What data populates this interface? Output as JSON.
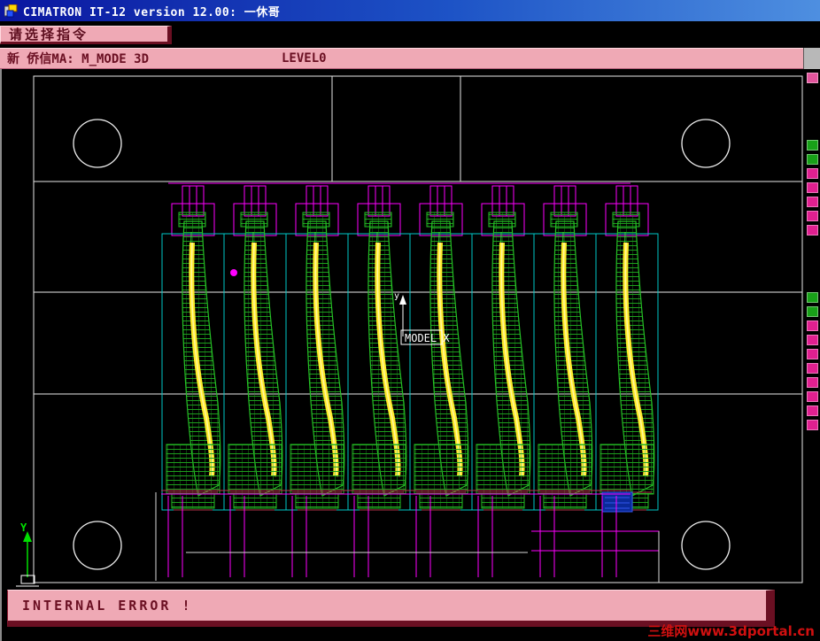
{
  "window": {
    "title": "CIMATRON IT-12 version 12.00: 一休哥"
  },
  "prompt_bar": {
    "text": "请选择指令"
  },
  "status_bar": {
    "mode_text": "新 侨信MA:  M_MODE  3D",
    "level": "LEVEL0"
  },
  "viewport": {
    "axis_label": "MODEL X",
    "center_y_label": "y",
    "origin_y_label": "Y"
  },
  "error_bar": {
    "text": "INTERNAL ERROR !"
  },
  "watermark": {
    "text": "三维网www.3dportal.cn"
  },
  "right_toolbar": {
    "buttons": [
      "#e2559c",
      "#18a018",
      "#18a018",
      "#e02090",
      "#e02090",
      "#e02090",
      "#e02090",
      "#e02090",
      "#18a018",
      "#18a018",
      "#e02090",
      "#e02090",
      "#e02090",
      "#e02090",
      "#e02090",
      "#e02090",
      "#e02090",
      "#e02090"
    ]
  },
  "colors": {
    "titlebar_blue_dark": "#0a16a0",
    "titlebar_blue_light": "#4e8fe0",
    "panel_pink": "#efa9b5",
    "panel_text_maroon": "#6a0f22",
    "viewport_background": "#000000",
    "wireframe_green": "#25c025",
    "wireframe_yellow": "#ffe929",
    "wireframe_magenta": "#ff00ff",
    "wireframe_cyan": "#00c8c8",
    "plate_white": "#ffffff",
    "watermark_red": "#d01010"
  }
}
